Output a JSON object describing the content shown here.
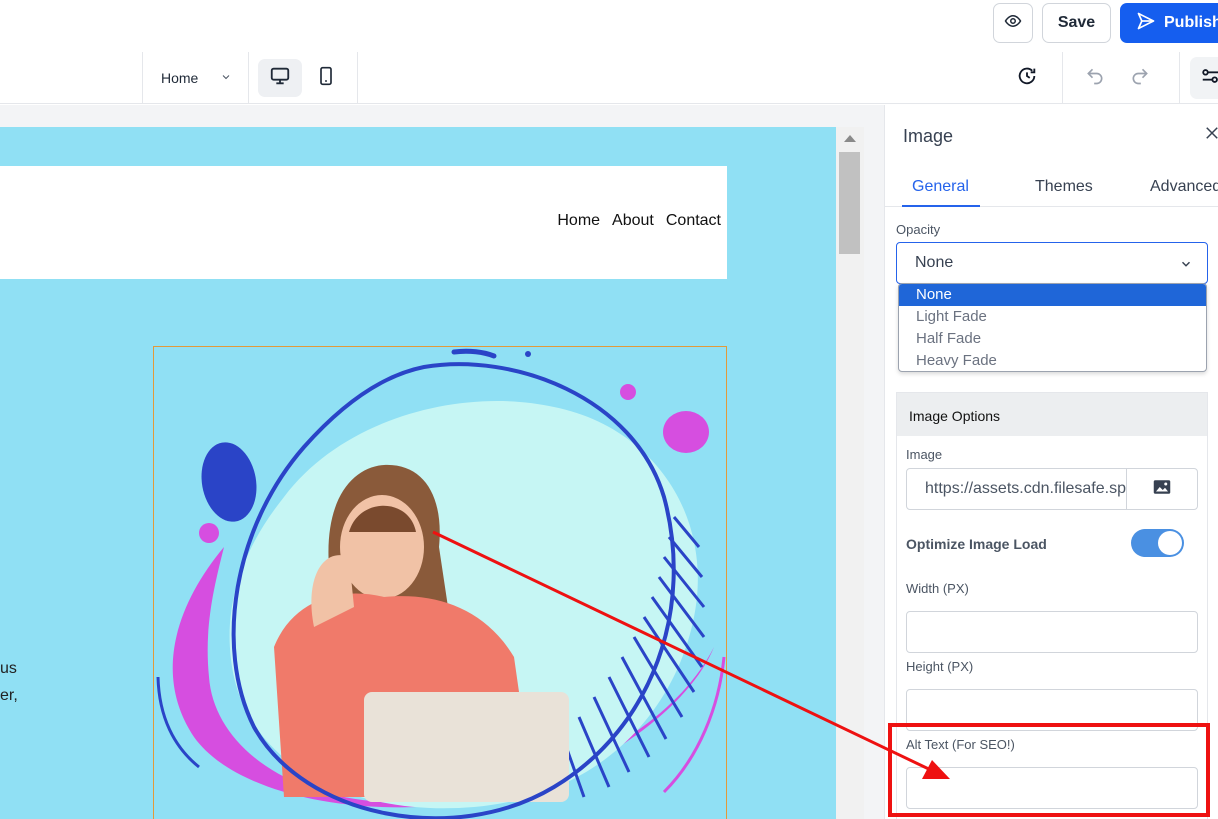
{
  "topbar": {
    "save_label": "Save",
    "publish_label": "Publish"
  },
  "toolbar": {
    "page_select": "Home"
  },
  "site": {
    "nav": [
      "Home",
      "About",
      "Contact"
    ],
    "partial_text": [
      "us",
      "er,"
    ]
  },
  "panel": {
    "title": "Image",
    "tabs": [
      "General",
      "Themes",
      "Advanced"
    ],
    "active_tab": "General",
    "opacity": {
      "label": "Opacity",
      "value": "None",
      "options": [
        "None",
        "Light Fade",
        "Half Fade",
        "Heavy Fade"
      ]
    },
    "image_options": {
      "header": "Image Options",
      "image_label": "Image",
      "image_url": "https://assets.cdn.filesafe.space",
      "optimize_label": "Optimize Image Load",
      "optimize_on": true,
      "width_label": "Width (PX)",
      "height_label": "Height (PX)",
      "alt_label": "Alt Text (For SEO!)"
    }
  },
  "colors": {
    "accent": "#155eef",
    "canvas_bg": "#90e0f4",
    "annotation": "#ee1111",
    "toggle": "#4a90e2"
  }
}
